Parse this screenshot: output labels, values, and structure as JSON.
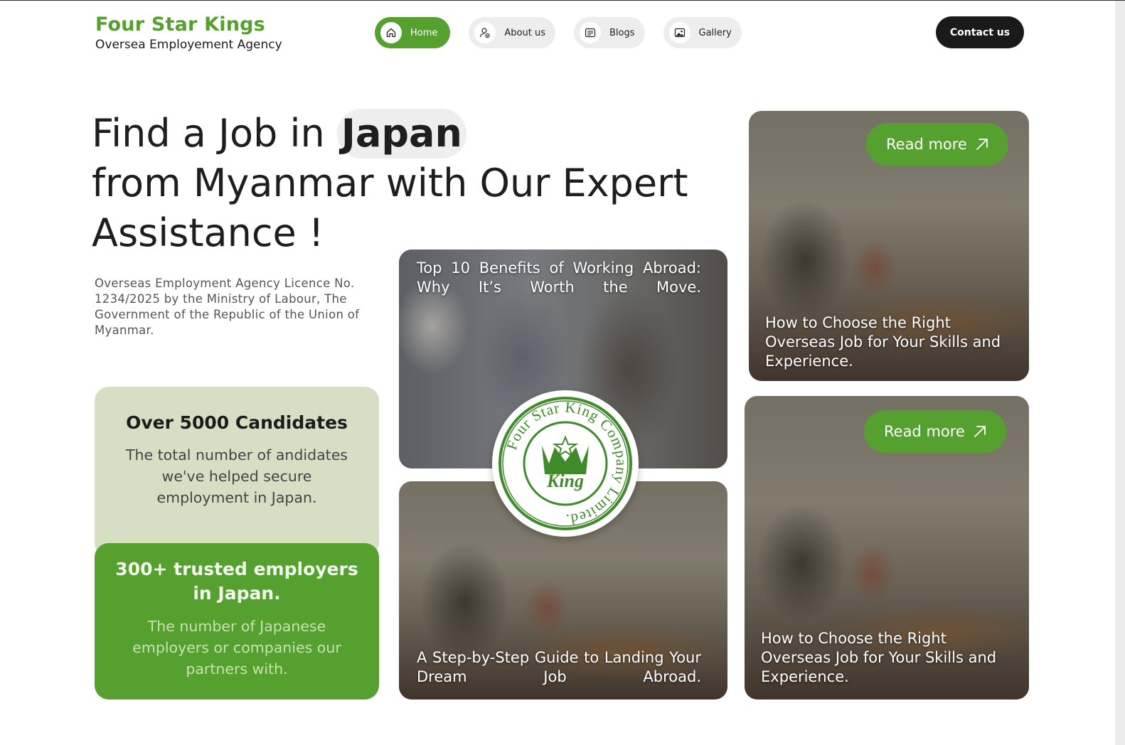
{
  "brand": {
    "name": "Four Star Kings",
    "subtitle": "Oversea Employement Agency"
  },
  "nav": {
    "items": [
      {
        "label": "Home",
        "icon": "home-icon",
        "active": true
      },
      {
        "label": "About us",
        "icon": "user-icon",
        "active": false
      },
      {
        "label": "Blogs",
        "icon": "document-icon",
        "active": false
      },
      {
        "label": "Gallery",
        "icon": "image-icon",
        "active": false
      }
    ],
    "contact_label": "Contact us"
  },
  "hero": {
    "line1_prefix": "Find a Job in ",
    "highlight": "Japan",
    "line2": "from Myanmar with Our Expert",
    "line3": "Assistance !",
    "licence": "Overseas Employment Agency Licence No. 1234/2025 by the Ministry of Labour, The Government of the Republic of the Union of Myanmar."
  },
  "stats": [
    {
      "title": "Over 5000 Candidates",
      "description": "The total number of andidates we've helped secure employment in Japan."
    },
    {
      "title": "300+ trusted employers in Japan.",
      "description": "The number of Japanese employers or companies our partners with."
    }
  ],
  "cards": [
    {
      "title": "Top 10 Benefits of Working Abroad: Why It’s Worth the Move."
    },
    {
      "title": "A Step-by-Step Guide to Landing Your Dream Job Abroad."
    },
    {
      "title": "How to Choose the Right Overseas Job for Your Skills and Experience.",
      "button": "Read more"
    },
    {
      "title": "How to Choose the Right Overseas Job for Your Skills and Experience.",
      "button": "Read more"
    }
  ],
  "badge": {
    "ring_text": "Four Star King Company Limited.",
    "center_text": "King"
  },
  "colors": {
    "accent": "#55a02f",
    "stat_light": "#d6dfc4",
    "dark": "#1a1a1a"
  }
}
